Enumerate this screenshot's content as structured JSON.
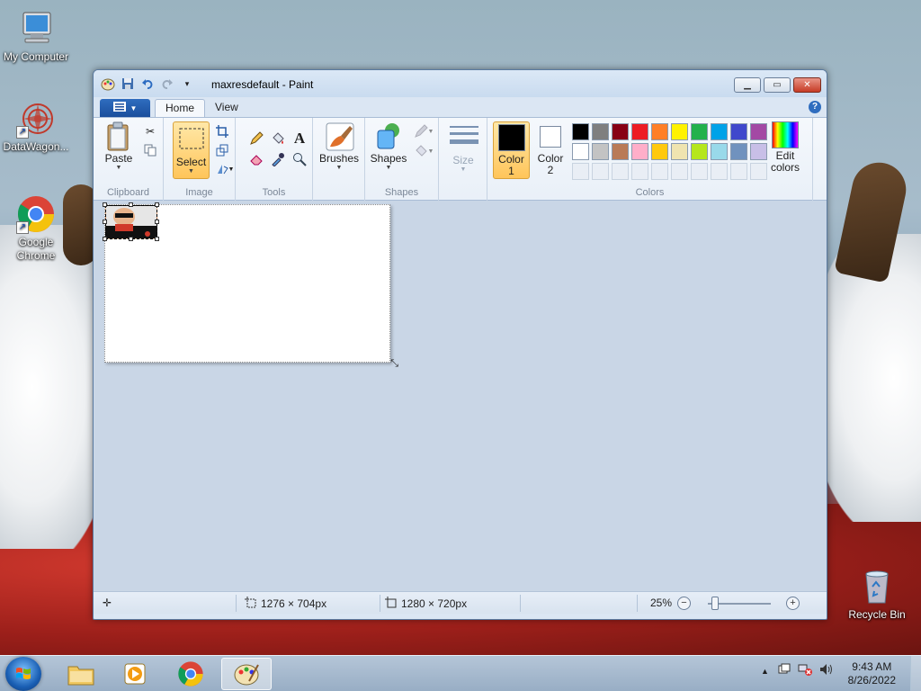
{
  "desktop": {
    "icons": [
      {
        "label": "My Computer"
      },
      {
        "label": "DataWagon..."
      },
      {
        "label": "Google Chrome"
      },
      {
        "label": "Recycle Bin"
      }
    ]
  },
  "window": {
    "title": "maxresdefault - Paint",
    "tabs": {
      "home": "Home",
      "view": "View"
    },
    "help": "?"
  },
  "ribbon": {
    "clipboard": {
      "group": "Clipboard",
      "paste": "Paste"
    },
    "image": {
      "group": "Image",
      "select": "Select"
    },
    "tools": {
      "group": "Tools",
      "text_tool": "A"
    },
    "brushes": {
      "label": "Brushes"
    },
    "shapes": {
      "group": "Shapes",
      "shapes": "Shapes"
    },
    "size": {
      "label": "Size"
    },
    "colors": {
      "group": "Colors",
      "color1": {
        "line1": "Color",
        "line2": "1",
        "value": "#000000"
      },
      "color2": {
        "line1": "Color",
        "line2": "2",
        "value": "#ffffff"
      },
      "edit": {
        "line1": "Edit",
        "line2": "colors"
      },
      "palette_row1": [
        "#000000",
        "#7f7f7f",
        "#880015",
        "#ed1c24",
        "#ff7f27",
        "#fff200",
        "#22b14c",
        "#00a2e8",
        "#3f48cc",
        "#a349a4"
      ],
      "palette_row2": [
        "#ffffff",
        "#c3c3c3",
        "#b97a57",
        "#ffaec9",
        "#ffc90e",
        "#efe4b0",
        "#b5e61d",
        "#99d9ea",
        "#7092be",
        "#c8bfe7"
      ],
      "custom_slots": 10
    }
  },
  "status": {
    "selection_size": "1276 × 704px",
    "image_size": "1280 × 720px",
    "zoom": "25%",
    "zoom_fraction": 0.12
  },
  "taskbar": {
    "time": "9:43 AM",
    "date": "8/26/2022"
  }
}
